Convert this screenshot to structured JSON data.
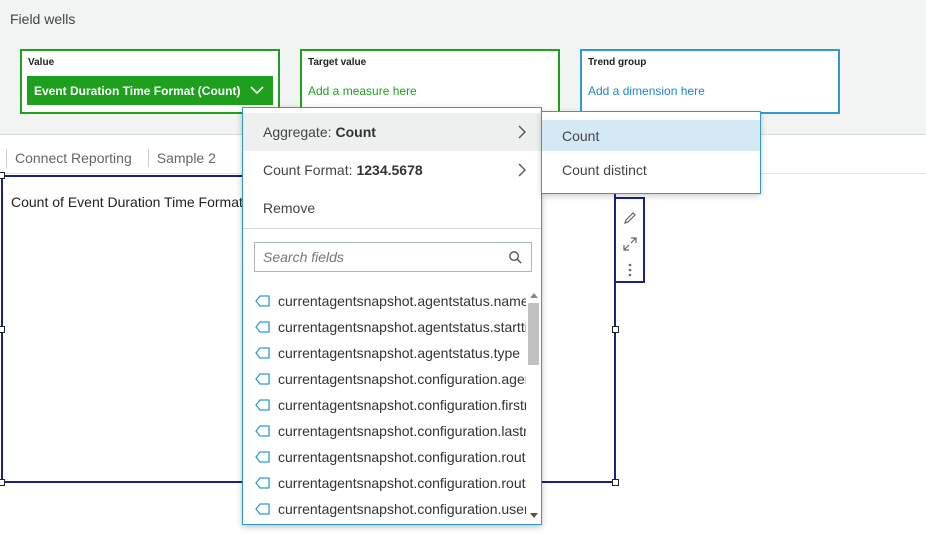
{
  "field_wells": {
    "title": "Field wells",
    "value": {
      "label": "Value",
      "chip": "Event Duration Time Format (Count)"
    },
    "target": {
      "label": "Target value",
      "placeholder": "Add a measure here"
    },
    "trend": {
      "label": "Trend group",
      "placeholder": "Add a dimension here"
    },
    "colors": {
      "measure": "#1ea01e",
      "dimension": "#2e9ad0"
    }
  },
  "sheet_tabs": [
    "Connect Reporting",
    "Sample 2"
  ],
  "visual": {
    "title": "Count of Event Duration Time Format"
  },
  "visual_toolbar": {
    "icons": [
      "pencil-icon",
      "expand-icon",
      "more-vertical-icon"
    ]
  },
  "menu": {
    "aggregate": {
      "label": "Aggregate:",
      "value": "Count"
    },
    "count_format": {
      "label": "Count Format:",
      "value": "1234.5678"
    },
    "remove": "Remove",
    "search_placeholder": "Search fields",
    "fields": [
      "currentagentsnapshot.agentstatus.name",
      "currentagentsnapshot.agentstatus.starttimestamp",
      "currentagentsnapshot.agentstatus.type",
      "currentagentsnapshot.configuration.agenthierarchygroups",
      "currentagentsnapshot.configuration.firstname",
      "currentagentsnapshot.configuration.lastname",
      "currentagentsnapshot.configuration.routingprofile",
      "currentagentsnapshot.configuration.routingprofile.name",
      "currentagentsnapshot.configuration.username"
    ]
  },
  "submenu": {
    "items": [
      "Count",
      "Count distinct"
    ],
    "selected": "Count"
  }
}
